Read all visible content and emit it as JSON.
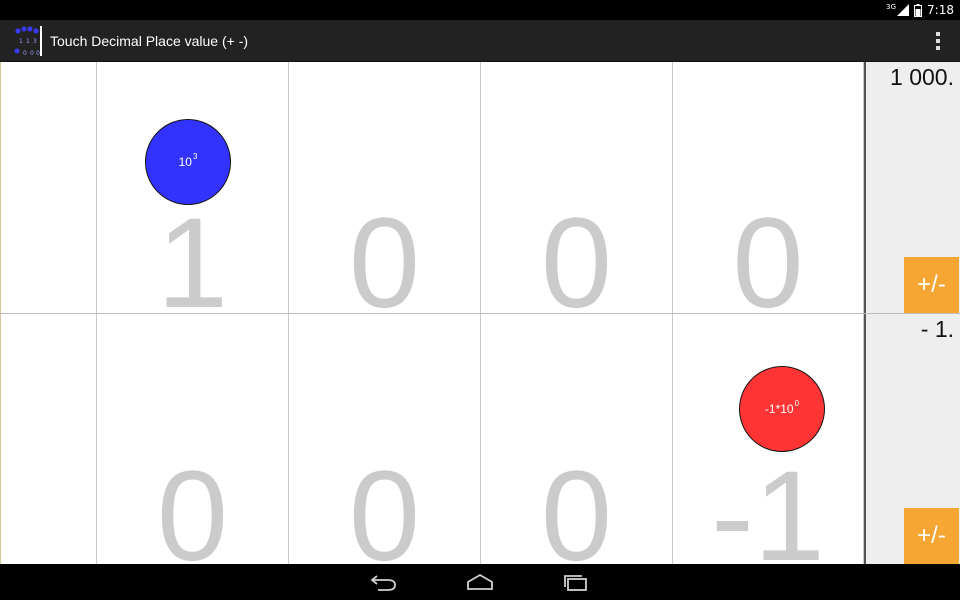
{
  "status_bar": {
    "network": "3G",
    "time": "7:18",
    "icons": [
      "signal-icon",
      "battery-icon"
    ]
  },
  "action_bar": {
    "title": "Touch Decimal Place value (+ -)",
    "icon": "app-icon",
    "menu_icon": "overflow-menu-icon"
  },
  "rows": [
    {
      "digits": [
        "",
        "1",
        "0",
        "0",
        "0"
      ],
      "value": "1 000.",
      "sign_button": "+/-",
      "counter": {
        "base": "10",
        "exponent": "3",
        "color": "#3333ff"
      }
    },
    {
      "digits": [
        "",
        "0",
        "0",
        "0",
        "-1"
      ],
      "value": "- 1.",
      "sign_button": "+/-",
      "counter": {
        "base": "-1*10",
        "exponent": "0",
        "color": "#ff3535"
      }
    }
  ],
  "colors": {
    "action_bar": "#222222",
    "sign_button": "#f6a632",
    "digit": "#cbcbcb",
    "side_panel": "#eeeeee"
  },
  "nav_bar": {
    "icons": [
      "back-icon",
      "home-icon",
      "recent-apps-icon"
    ]
  }
}
